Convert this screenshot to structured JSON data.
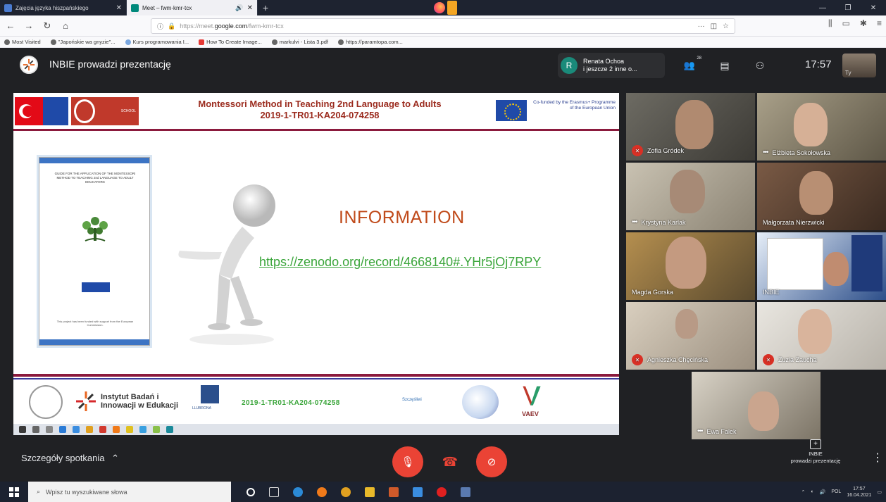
{
  "browser": {
    "tabs": [
      {
        "title": "Zajęcia języka hiszpańskiego",
        "active": false,
        "favicon_color": "#4a7bd0"
      },
      {
        "title": "Meet – fwm-kmr-tcx",
        "active": true,
        "favicon_color": "#00897b"
      }
    ],
    "new_tab": "+",
    "url_prefix": "https://meet.",
    "url_domain": "google.com",
    "url_path": "/fwm-kmr-tcx",
    "url_dots": "···",
    "bookmarks": [
      "Most Visited",
      "\"Japońskie wa gnyzie\"...",
      "Kurs programowania I...",
      "How To Create Image...",
      "markulvi - Lista 3.pdf",
      "https://paramtopa.com..."
    ]
  },
  "meet": {
    "presenter_title": "INBIE prowadzi prezentację",
    "participants_chip": {
      "initial": "R",
      "line1": "Renata Ochoa",
      "line2": "i jeszcze 2 inne o..."
    },
    "participant_count": "28",
    "clock": "17:57",
    "self_label": "Ty",
    "details_label": "Szczegóły spotkania",
    "present_box": {
      "line1": "INBIE",
      "line2": "prowadzi prezentację"
    },
    "participants": [
      {
        "name": "Zofia Gródek",
        "state": "muted"
      },
      {
        "name": "Elżbieta Sokołowska",
        "state": "dots"
      },
      {
        "name": "Krystyna Karlak",
        "state": "dots"
      },
      {
        "name": "Małgorzata Nierzwicki",
        "state": "none"
      },
      {
        "name": "Magda Gorska",
        "state": "none"
      },
      {
        "name": "INBIE",
        "state": "none"
      },
      {
        "name": "Agnieszka Chęcińska",
        "state": "muted"
      },
      {
        "name": "Zuzia Zaucha",
        "state": "muted"
      },
      {
        "name": "Ewa Falek",
        "state": "dots"
      }
    ]
  },
  "slide": {
    "title_line1": "Montessori Method in Teaching 2nd Language to Adults",
    "title_line2": "2019-1-TR01-KA204-074258",
    "eu_text": "Co-funded by the Erasmus+ Programme of the European Union",
    "school_logo_text": "SCHOOL",
    "booklet_title": "GUIDE FOR THE APPLICATION OF THE MONTESSORI METHOD TO TEACHING 2nd LANGUAGE TO ADULT EDUCATORS",
    "booklet_footer": "This project has been funded with support from the European Commission.",
    "info_title": "INFORMATION",
    "info_link": "https://zenodo.org/record/4668140#.YHr5jOj7RPY",
    "footer_ibie_line1": "Instytut Badań i",
    "footer_ibie_line2": "Innowacji w Edukacji",
    "footer_l_text": "LLUBRONA",
    "footer_code": "2019-1-TR01-KA204-074258",
    "footer_sw_text": "Szczęśliwi",
    "footer_vaev": "VAEV"
  },
  "taskbar": {
    "search_placeholder": "Wpisz tu wyszukiwane słowa",
    "time": "17:57",
    "date": "16.04.2021",
    "lang": "POL"
  }
}
